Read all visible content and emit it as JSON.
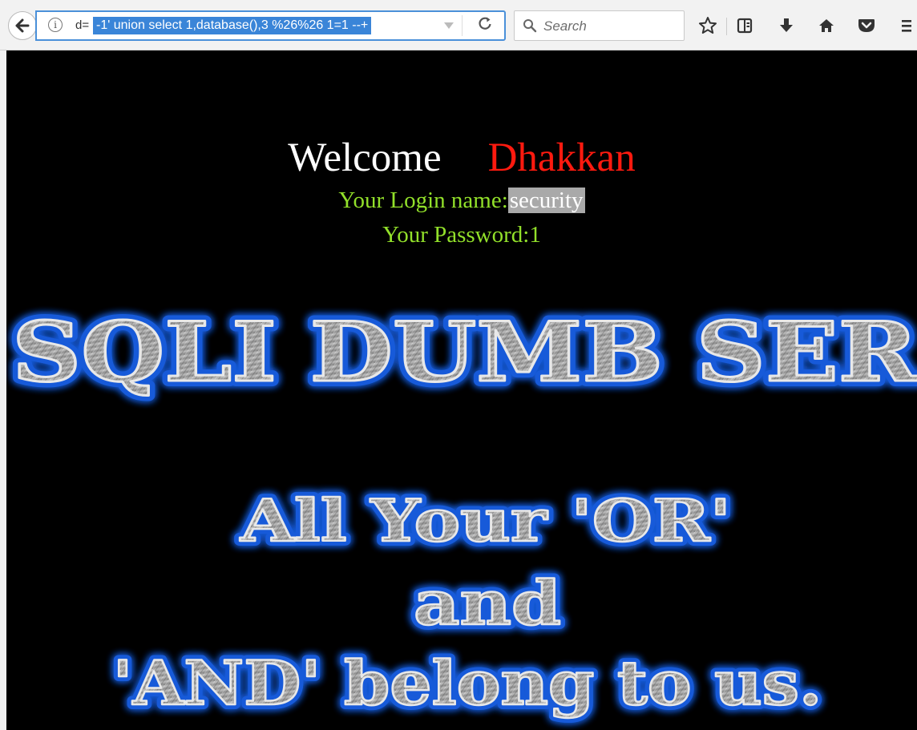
{
  "browser": {
    "url_prefix": "d=",
    "url_selected": "-1' union select 1,database(),3 %26%26 1=1 --+",
    "search_placeholder": "Search",
    "accent": "#3a85d8"
  },
  "toolbar_icons": [
    "back-arrow-icon",
    "info-icon",
    "dropdown-icon",
    "reload-icon",
    "search-icon",
    "star-icon",
    "reading-list-icon",
    "download-icon",
    "home-icon",
    "pocket-icon",
    "menu-icon"
  ],
  "page": {
    "background": "#000000",
    "welcome": "Welcome",
    "name": "Dhakkan",
    "login_label": "Your Login name:",
    "login_value": "security",
    "password_label": "Your Password:",
    "password_value": "1",
    "banner_title": "SQLI DUMB SER",
    "slogan_line1": "All Your 'OR'",
    "slogan_line2": "and",
    "slogan_line3": "'AND' belong to us.",
    "colors": {
      "welcome": "#ffffff",
      "name": "#ff1a0f",
      "login_text": "#92e02a",
      "banner_fill": "#9a9a9a",
      "banner_glow": "#1e6bff"
    }
  }
}
